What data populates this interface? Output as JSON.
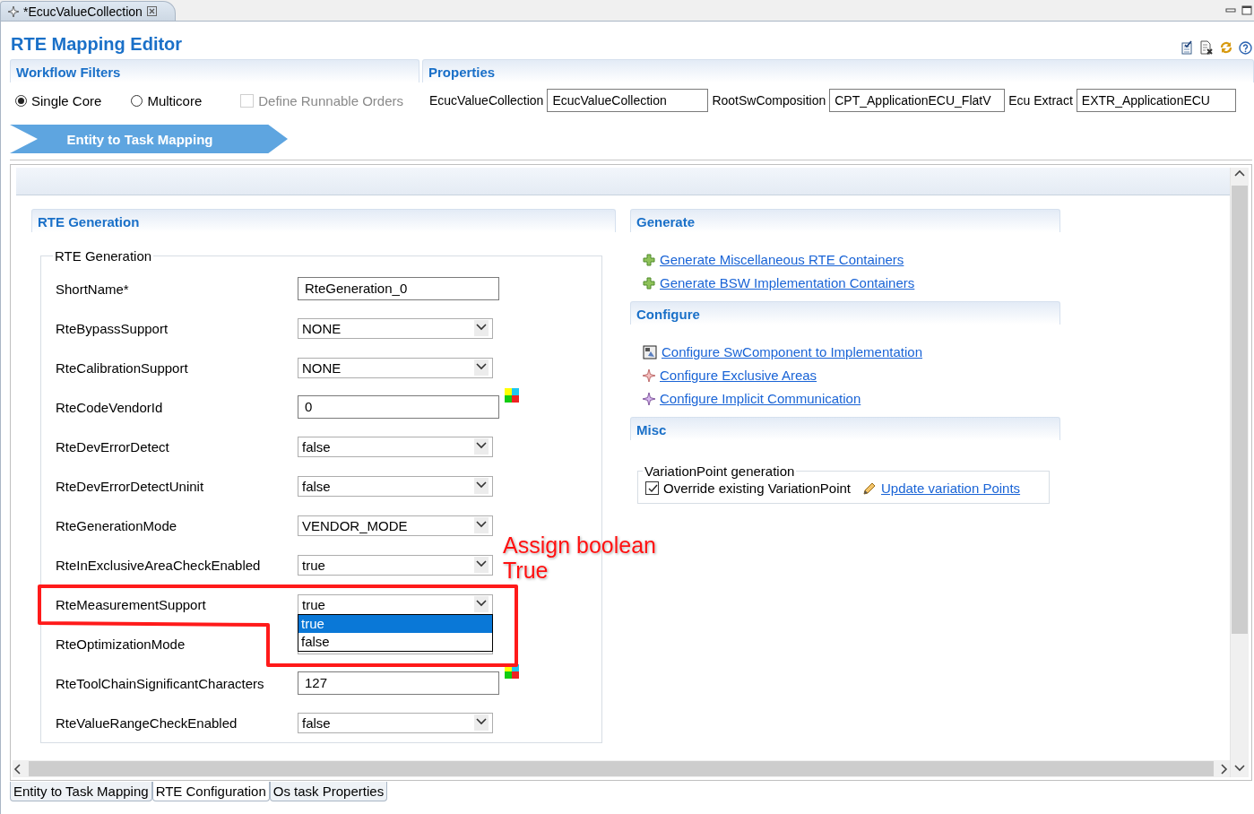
{
  "editor_tab": {
    "title": "*EcucValueCollection"
  },
  "title": "RTE Mapping Editor",
  "workflow_filters": {
    "title": "Workflow Filters",
    "options": [
      {
        "kind": "radio",
        "label": "Single Core",
        "selected": true
      },
      {
        "kind": "radio",
        "label": "Multicore",
        "selected": false
      },
      {
        "kind": "checkbox",
        "label": "Define Runnable Orders",
        "checked": false,
        "disabled": true
      }
    ]
  },
  "properties": {
    "title": "Properties",
    "fields": [
      {
        "label": "EcucValueCollection",
        "value": "EcucValueCollection"
      },
      {
        "label": "RootSwComposition",
        "value": "CPT_ApplicationECU_FlatV"
      },
      {
        "label": "Ecu Extract",
        "value": "EXTR_ApplicationECU"
      }
    ]
  },
  "workflow_step": {
    "label": "Entity to Task Mapping"
  },
  "rte_generation": {
    "title": "RTE Generation",
    "group_title": "RTE Generation",
    "rows": [
      {
        "label": "ShortName*",
        "kind": "text",
        "value": "RteGeneration_0"
      },
      {
        "label": "RteBypassSupport",
        "kind": "combo",
        "value": "NONE"
      },
      {
        "label": "RteCalibrationSupport",
        "kind": "combo",
        "value": "NONE"
      },
      {
        "label": "RteCodeVendorId",
        "kind": "number",
        "value": "0"
      },
      {
        "label": "RteDevErrorDetect",
        "kind": "combo",
        "value": "false"
      },
      {
        "label": "RteDevErrorDetectUninit",
        "kind": "combo",
        "value": "false"
      },
      {
        "label": "RteGenerationMode",
        "kind": "combo",
        "value": "VENDOR_MODE"
      },
      {
        "label": "RteInExclusiveAreaCheckEnabled",
        "kind": "combo",
        "value": "true"
      },
      {
        "label": "RteMeasurementSupport",
        "kind": "combo",
        "value": "true",
        "open_list": [
          {
            "label": "true",
            "selected": true
          },
          {
            "label": "false",
            "selected": false
          }
        ]
      },
      {
        "label": "RteOptimizationMode",
        "kind": "combo"
      },
      {
        "label": "RteToolChainSignificantCharacters",
        "kind": "number",
        "value": "127"
      },
      {
        "label": "RteValueRangeCheckEnabled",
        "kind": "combo",
        "value": "false"
      }
    ]
  },
  "annotation": {
    "text": "Assign boolean True"
  },
  "generate": {
    "title": "Generate",
    "links": [
      {
        "kind": "plus",
        "label": "Generate Miscellaneous RTE Containers"
      },
      {
        "kind": "plus",
        "label": "Generate BSW Implementation Containers"
      }
    ]
  },
  "configure": {
    "title": "Configure",
    "links": [
      {
        "kind": "component",
        "label": "Configure SwComponent to Implementation "
      },
      {
        "kind": "star",
        "label": "Configure Exclusive Areas"
      },
      {
        "kind": "star-purple",
        "label": "Configure Implicit Communication"
      }
    ]
  },
  "misc": {
    "title": "Misc",
    "group_title": "VariationPoint generation",
    "checkbox": {
      "label": "Override existing VariationPoint",
      "checked": true
    },
    "link": "Update variation Points"
  },
  "bottom_tabs": [
    {
      "label": "Entity to Task Mapping",
      "selected": false
    },
    {
      "label": "RTE Configuration",
      "selected": true
    },
    {
      "label": "Os task Properties",
      "selected": false
    }
  ]
}
